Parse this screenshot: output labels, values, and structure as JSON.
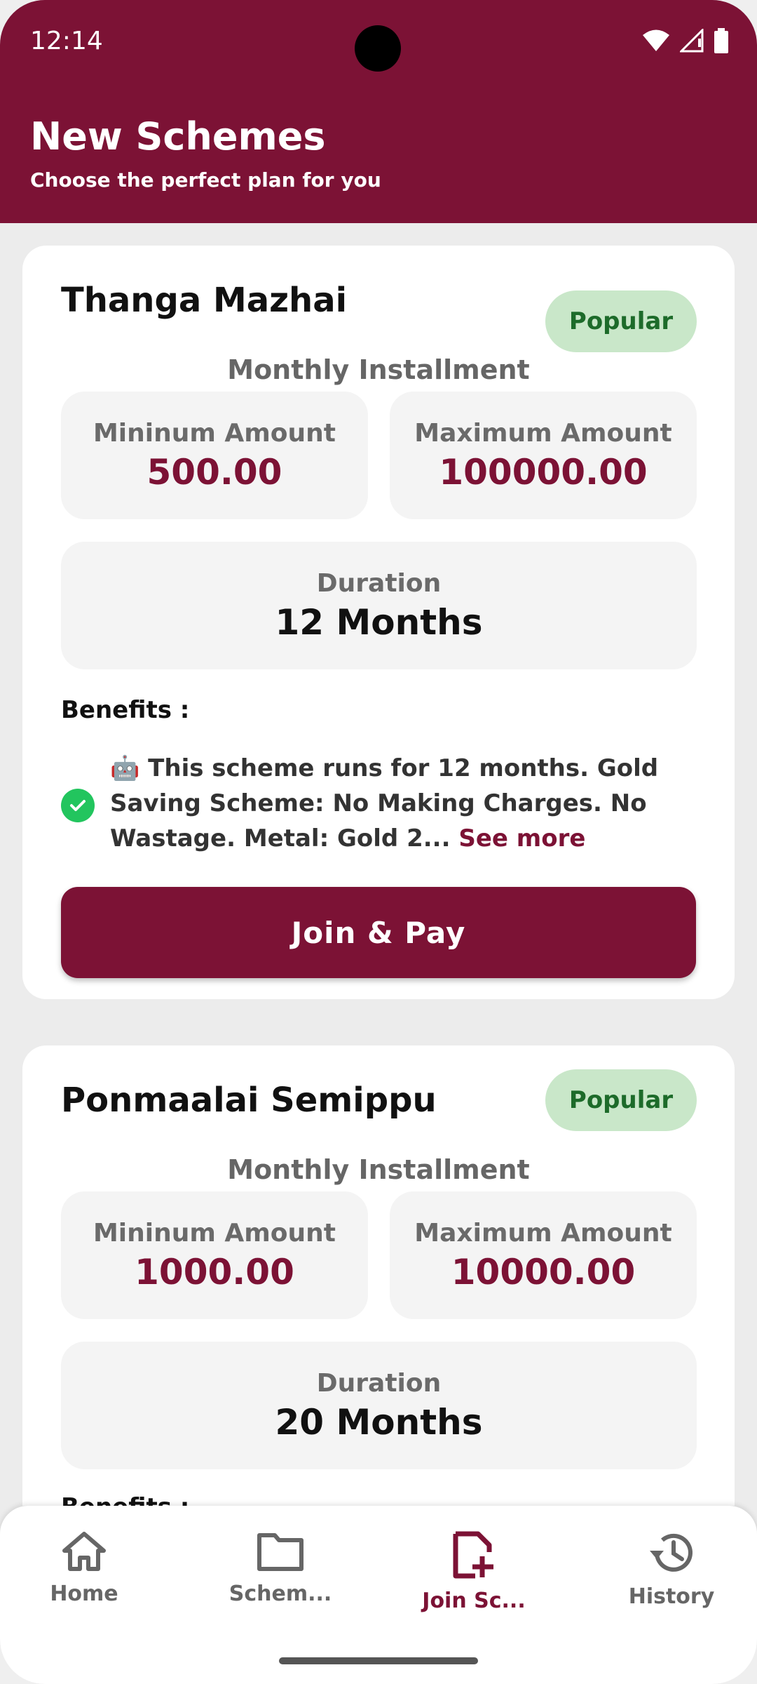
{
  "status_bar": {
    "time": "12:14"
  },
  "header": {
    "title": "New Schemes",
    "subtitle": "Choose the perfect plan for you"
  },
  "schemes": [
    {
      "name": "Thanga Mazhai",
      "badge": "Popular",
      "installment_label": "Monthly Installment",
      "min_label": "Mininum Amount",
      "min_value": "500.00",
      "max_label": "Maximum Amount",
      "max_value": "100000.00",
      "duration_label": "Duration",
      "duration_value": "12 Months",
      "benefits_label": "Benefits :",
      "benefit_text": "🤖 This scheme runs for 12 months. Gold Saving Scheme: No Making Charges. No Wastage. Metal: Gold 2...",
      "see_more": "See more",
      "join_label": "Join & Pay"
    },
    {
      "name": "Ponmaalai Semippu",
      "badge": "Popular",
      "installment_label": "Monthly Installment",
      "min_label": "Mininum Amount",
      "min_value": "1000.00",
      "max_label": "Maximum Amount",
      "max_value": "10000.00",
      "duration_label": "Duration",
      "duration_value": "20 Months",
      "benefits_label": "Benefits :"
    }
  ],
  "bottom_nav": {
    "items": [
      {
        "label": "Home",
        "icon": "home-icon",
        "active": false
      },
      {
        "label": "Schem...",
        "icon": "folder-icon",
        "active": false
      },
      {
        "label": "Join Sc...",
        "icon": "add-document-icon",
        "active": true
      },
      {
        "label": "History",
        "icon": "history-icon",
        "active": false
      }
    ]
  },
  "colors": {
    "primary": "#7c1235",
    "badge_bg": "#c9e7c9",
    "badge_text": "#1d6b2a",
    "check": "#22c55e"
  }
}
